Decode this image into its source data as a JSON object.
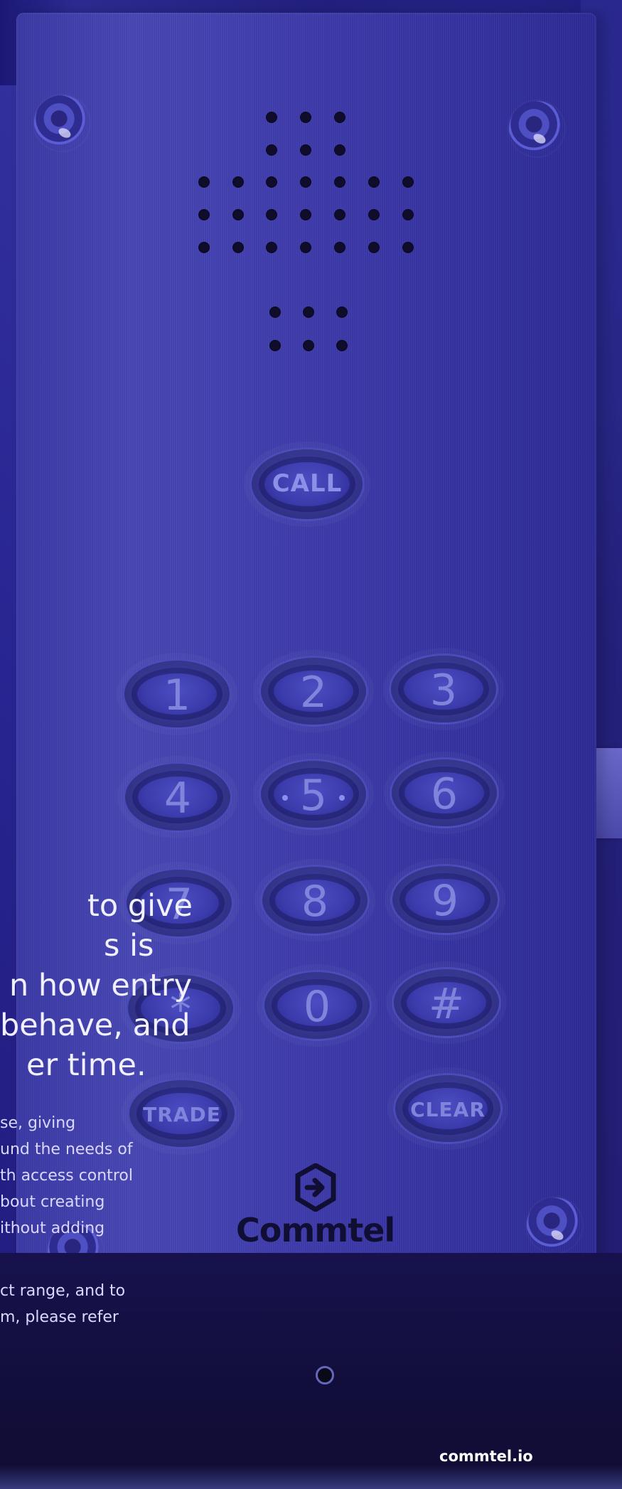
{
  "hero_copy": {
    "lines": [
      "to give",
      "s is",
      "n how entry",
      "behave, and",
      "er time."
    ]
  },
  "body_copy": {
    "lines": [
      "se, giving",
      "und the needs of",
      "th access control",
      "bout creating",
      "ithout adding"
    ]
  },
  "footnote_copy": {
    "lines": [
      "ct range, and to",
      "m, please refer"
    ]
  },
  "device": {
    "call_label": "CALL",
    "keys": [
      [
        "1",
        "2",
        "3"
      ],
      [
        "4",
        "5",
        "6"
      ],
      [
        "7",
        "8",
        "9"
      ],
      [
        "*",
        "0",
        "#"
      ]
    ],
    "trade_label": "TRADE",
    "clear_label": "CLEAR",
    "brand_name": "Commtel",
    "brand_icon": "commtel-logo-icon"
  },
  "footer": {
    "link": "commtel.io"
  },
  "colors": {
    "background": "#1b1672",
    "panel": "#3b39a7",
    "text": "#f1f0ff",
    "brand": "#100f33"
  }
}
